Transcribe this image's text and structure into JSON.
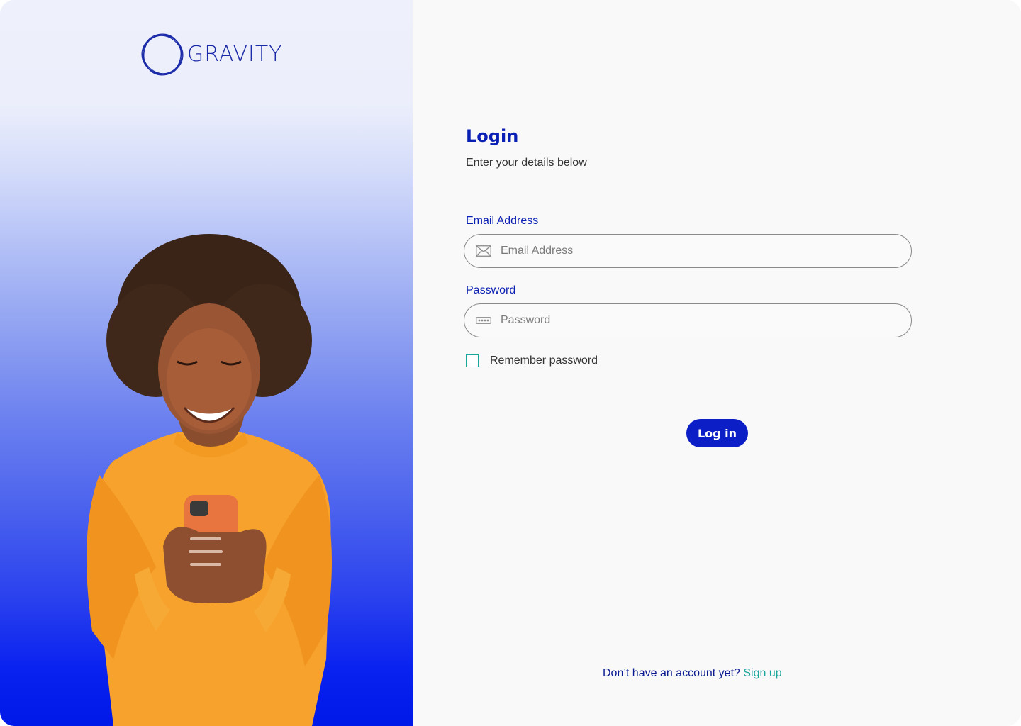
{
  "brand": {
    "name": "GRAVITY",
    "logo_icon": "orbit-rings-logo-icon"
  },
  "hero": {
    "image": "woman-in-orange-sweater-smiling-at-phone"
  },
  "form": {
    "title": "Login",
    "subtitle": "Enter your details below",
    "email": {
      "label": "Email Address",
      "placeholder": "Email Address",
      "value": "",
      "icon": "envelope-icon"
    },
    "password": {
      "label": "Password",
      "placeholder": "Password",
      "value": "",
      "icon": "password-dots-icon"
    },
    "remember": {
      "label": "Remember password",
      "checked": false
    },
    "submit_label": "Log in"
  },
  "footer": {
    "prompt": "Don’t have an account yet?",
    "link_label": "Sign up"
  },
  "colors": {
    "primary": "#0c1ec6",
    "accent_teal": "#1aa69a",
    "label_blue": "#0a1fb3",
    "panel_background": "#f9f9f9"
  }
}
